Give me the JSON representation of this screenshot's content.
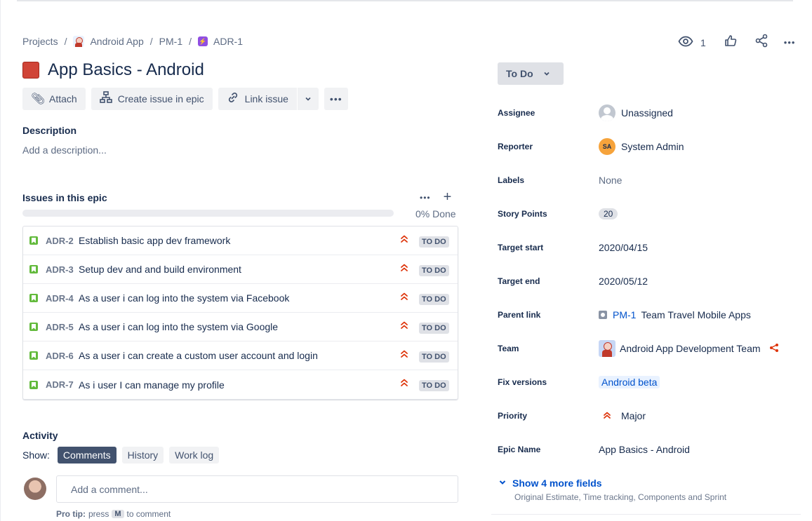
{
  "breadcrumb": [
    {
      "label": "Projects",
      "icon": ""
    },
    {
      "label": "Android App",
      "icon": "app-avatar-icon"
    },
    {
      "label": "PM-1",
      "icon": ""
    },
    {
      "label": "ADR-1",
      "icon": "epic-icon"
    }
  ],
  "title": "App Basics - Android",
  "actions": {
    "attach": "Attach",
    "create_in_epic": "Create issue in epic",
    "link_issue": "Link issue"
  },
  "description": {
    "heading": "Description",
    "placeholder": "Add a description..."
  },
  "epic_issues": {
    "heading": "Issues in this epic",
    "progress_percent": 0,
    "progress_label": "0% Done",
    "issues": [
      {
        "key": "ADR-2",
        "summary": "Establish basic app dev framework",
        "status": "TO DO"
      },
      {
        "key": "ADR-3",
        "summary": "Setup dev and and build environment",
        "status": "TO DO"
      },
      {
        "key": "ADR-4",
        "summary": "As a user i can log into the system via Facebook",
        "status": "TO DO"
      },
      {
        "key": "ADR-5",
        "summary": "As a user i can log into the system via Google",
        "status": "TO DO"
      },
      {
        "key": "ADR-6",
        "summary": "As a user i can create a custom user account and login",
        "status": "TO DO"
      },
      {
        "key": "ADR-7",
        "summary": "As i user I can manage my profile",
        "status": "TO DO"
      }
    ]
  },
  "activity": {
    "heading": "Activity",
    "show_label": "Show:",
    "tabs": [
      "Comments",
      "History",
      "Work log"
    ],
    "active_tab": "Comments",
    "comment_placeholder": "Add a comment...",
    "protip_bold": "Pro tip:",
    "protip_press": "press",
    "protip_key": "M",
    "protip_rest": "to comment"
  },
  "header_right": {
    "watchers": "1"
  },
  "status": "To Do",
  "fields": {
    "assignee": {
      "label": "Assignee",
      "value": "Unassigned"
    },
    "reporter": {
      "label": "Reporter",
      "value": "System Admin",
      "initials": "SA"
    },
    "labels": {
      "label": "Labels",
      "value": "None"
    },
    "story_points": {
      "label": "Story Points",
      "value": "20"
    },
    "target_start": {
      "label": "Target start",
      "value": "2020/04/15"
    },
    "target_end": {
      "label": "Target end",
      "value": "2020/05/12"
    },
    "parent_link": {
      "label": "Parent link",
      "key": "PM-1",
      "value": "Team Travel Mobile Apps"
    },
    "team": {
      "label": "Team",
      "value": "Android App Development Team"
    },
    "fix_versions": {
      "label": "Fix versions",
      "value": "Android beta"
    },
    "priority": {
      "label": "Priority",
      "value": "Major"
    },
    "epic_name": {
      "label": "Epic Name",
      "value": "App Basics - Android"
    }
  },
  "show_more": {
    "label": "Show 4 more fields",
    "sub": "Original Estimate, Time tracking, Components and Sprint"
  },
  "colors": {
    "epic": "#d04437",
    "link": "#0052cc",
    "priority_major": "#de350b",
    "story": "#63ba3c"
  }
}
